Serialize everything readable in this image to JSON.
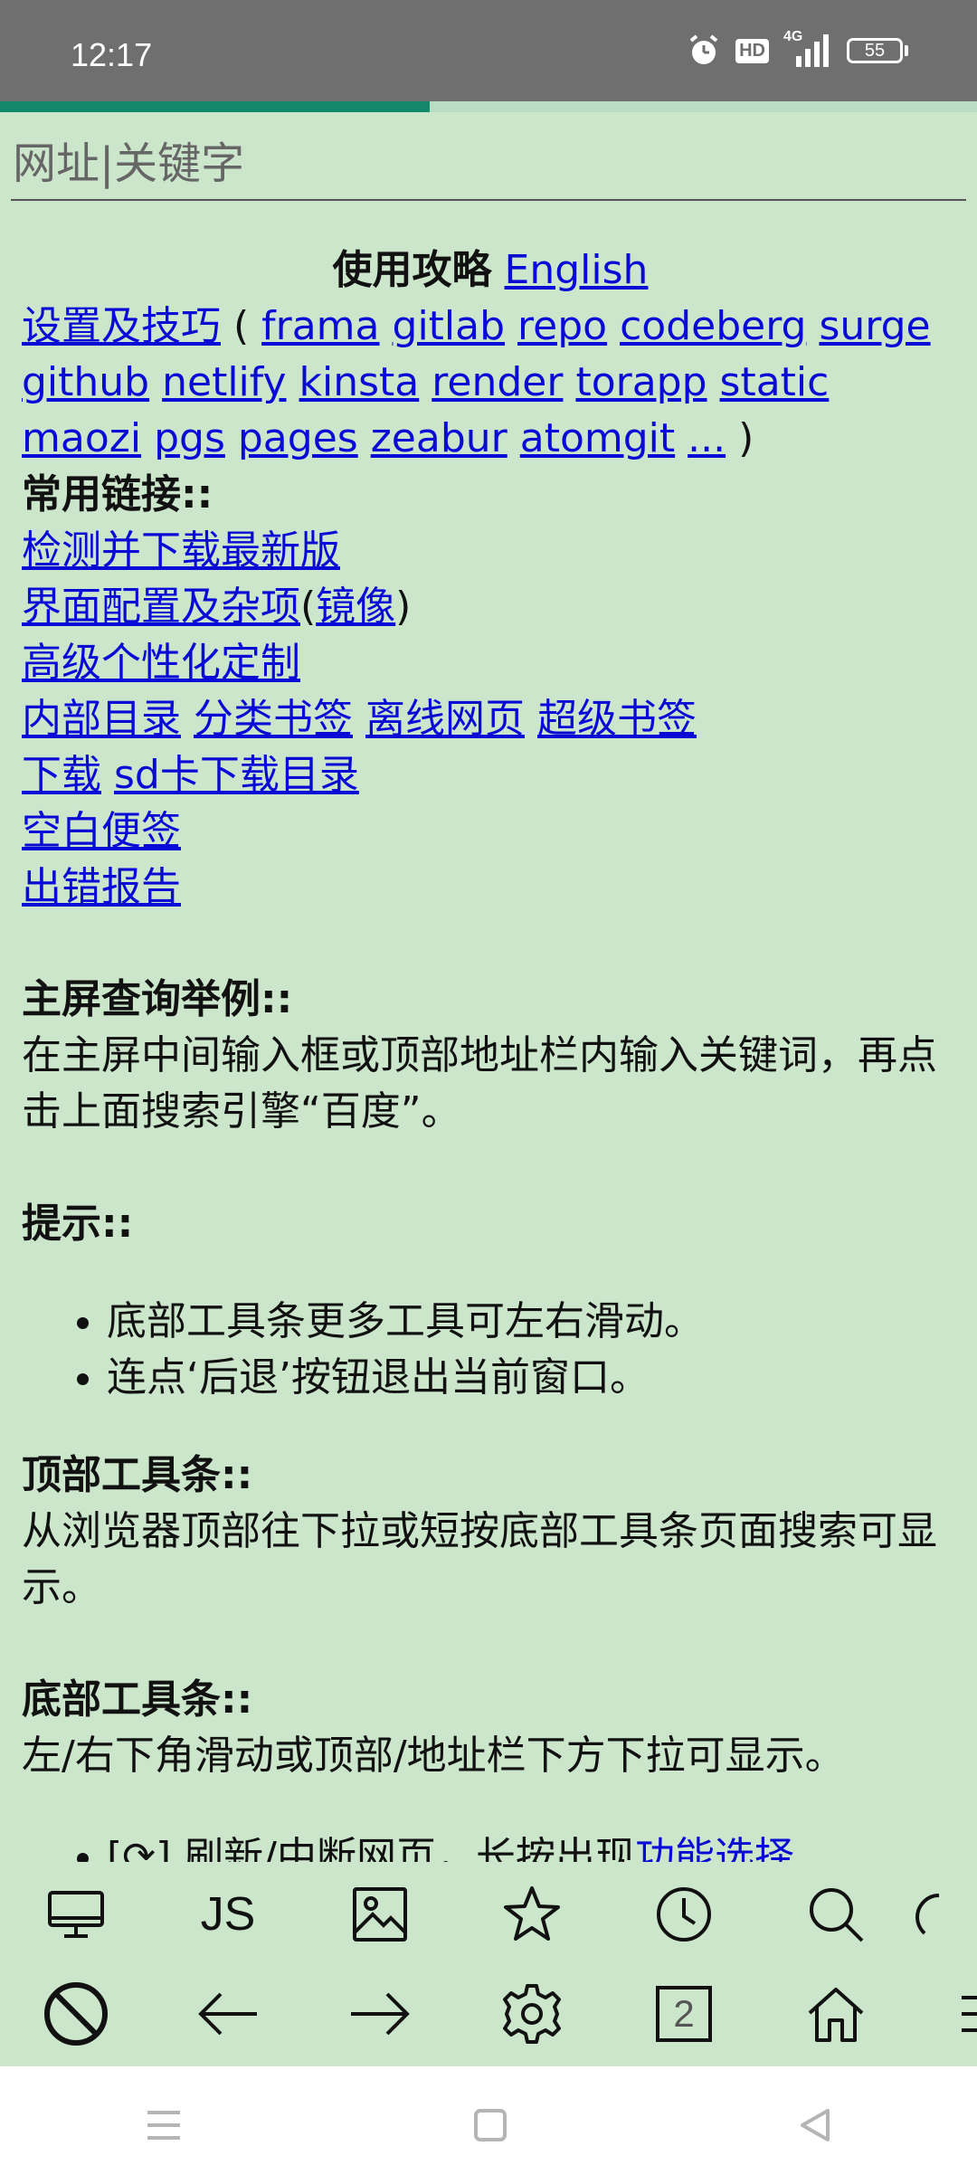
{
  "status_bar": {
    "time": "12:17",
    "hd_badge": "HD",
    "network": "4G",
    "battery": "55"
  },
  "page_load_progress": 0.44,
  "url_bar": {
    "placeholder": "网址|关键字"
  },
  "content": {
    "guide_title": "使用攻略",
    "english_link": "English",
    "settings_link": "设置及技巧",
    "mirrors_open": " ( ",
    "mirrors": [
      "frama",
      "gitlab",
      "repo",
      "codeberg",
      "surge",
      "github",
      "netlify",
      "kinsta",
      "render",
      "torapp",
      "static",
      "maozi",
      "pgs",
      "pages",
      "zeabur",
      "atomgit",
      "..."
    ],
    "mirrors_close": " )",
    "common_links_heading": "常用链接::",
    "link_check_update": "检测并下载最新版",
    "link_ui_config": "界面配置及杂项",
    "link_mirror_paren_open": "(",
    "link_mirror": "镜像",
    "link_mirror_paren_close": ")",
    "link_personalize": "高级个性化定制",
    "link_internal_dir": "内部目录",
    "link_category_bookmarks": "分类书签",
    "link_offline_pages": "离线网页",
    "link_super_bookmarks": "超级书签",
    "link_downloads": "下载",
    "link_sd_downloads": "sd卡下载目录",
    "link_blank_note": "空白便签",
    "link_error_report": "出错报告",
    "home_query_heading": "主屏查询举例::",
    "home_query_text": "在主屏中间输入框或顶部地址栏内输入关键词，再点击上面搜索引擎“百度”。",
    "tips_heading": "提示::",
    "tips": [
      "底部工具条更多工具可左右滑动。",
      "连点‘后退’按钮退出当前窗口。"
    ],
    "top_toolbar_heading": "顶部工具条::",
    "top_toolbar_text": "从浏览器顶部往下拉或短按底部工具条页面搜索可显示。",
    "bottom_toolbar_heading": "底部工具条::",
    "bottom_toolbar_text": "左/右下角滑动或顶部/地址栏下方下拉可显示。",
    "partial_item_text": "[⟳] 刷新/中断网页，长按出现",
    "partial_item_link": "功能选择"
  },
  "toolbar_top": {
    "js_label": "JS",
    "icons": [
      "desktop-icon",
      "image-icon",
      "star-icon",
      "clock-icon",
      "search-icon",
      "share-icon"
    ]
  },
  "toolbar_bottom": {
    "tab_count": "2",
    "icons": [
      "block-icon",
      "back-arrow-icon",
      "forward-arrow-icon",
      "gear-icon",
      "home-icon",
      "menu-icon"
    ]
  },
  "colors": {
    "background": "#cce6cc",
    "link": "#0a0ad6",
    "progress": "#13886b",
    "status_bar": "#6f6f6f"
  }
}
